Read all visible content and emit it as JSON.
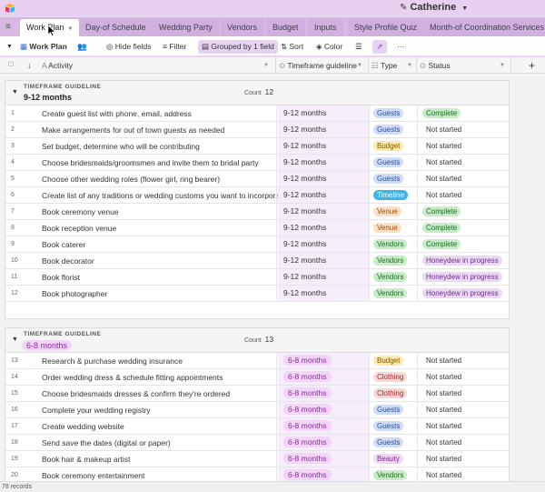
{
  "app": {
    "base_title": "Catherine",
    "pencil_icon": "pencil-icon",
    "brand_colors": {
      "topbar": "#e8d0f0",
      "tabsbar": "#d7b9e4",
      "accent": "#8a3fb8"
    }
  },
  "tabs": [
    {
      "label": "Work Plan",
      "active": true
    },
    {
      "label": "Day-of Schedule"
    },
    {
      "label": "Wedding Party"
    },
    {
      "label": "Vendors"
    },
    {
      "label": "Budget"
    },
    {
      "label": "Inputs"
    },
    {
      "label": "Style Profile Quiz"
    },
    {
      "label": "Month-of Coordination Services"
    }
  ],
  "toolbar": {
    "view_name": "Work Plan",
    "hide_fields": "Hide fields",
    "filter": "Filter",
    "grouped": "Grouped by 1 field",
    "sort": "Sort",
    "color": "Color",
    "more": "···"
  },
  "columns": {
    "activity": "Activity",
    "timeframe": "Timeframe guideline",
    "type": "Type",
    "status": "Status",
    "add": "+"
  },
  "groups": [
    {
      "label": "TIMEFRAME GUIDELINE",
      "value": "9-12 months",
      "count_label": "Count",
      "count": "12",
      "rows": [
        {
          "n": "1",
          "activity": "Create guest list with phone, email, address",
          "tf": "9-12 months",
          "type": "Guests",
          "status": "Complete"
        },
        {
          "n": "2",
          "activity": "Make arrangements for out of town guests as needed",
          "tf": "9-12 months",
          "type": "Guests",
          "status": "Not started"
        },
        {
          "n": "3",
          "activity": "Set budget, determine who will be contributing",
          "tf": "9-12 months",
          "type": "Budget",
          "status": "Not started"
        },
        {
          "n": "4",
          "activity": "Choose bridesmaids/groomsmen and invite them to bridal party",
          "tf": "9-12 months",
          "type": "Guests",
          "status": "Not started"
        },
        {
          "n": "5",
          "activity": "Choose other wedding roles (flower girl, ring bearer)",
          "tf": "9-12 months",
          "type": "Guests",
          "status": "Not started"
        },
        {
          "n": "6",
          "activity": "Create list of any traditions or wedding customs you want to incorporate",
          "tf": "9-12 months",
          "type": "Timeline",
          "status": "Not started"
        },
        {
          "n": "7",
          "activity": "Book ceremony venue",
          "tf": "9-12 months",
          "type": "Venue",
          "status": "Complete"
        },
        {
          "n": "8",
          "activity": "Book reception venue",
          "tf": "9-12 months",
          "type": "Venue",
          "status": "Complete"
        },
        {
          "n": "9",
          "activity": "Book caterer",
          "tf": "9-12 months",
          "type": "Vendors",
          "status": "Complete"
        },
        {
          "n": "10",
          "activity": "Book decorator",
          "tf": "9-12 months",
          "type": "Vendors",
          "status": "Honeydew in progress"
        },
        {
          "n": "11",
          "activity": "Book florist",
          "tf": "9-12 months",
          "type": "Vendors",
          "status": "Honeydew in progress"
        },
        {
          "n": "12",
          "activity": "Book photographer",
          "tf": "9-12 months",
          "type": "Vendors",
          "status": "Honeydew in progress"
        }
      ]
    },
    {
      "label": "TIMEFRAME GUIDELINE",
      "value": "6-8 months",
      "count_label": "Count",
      "count": "13",
      "rows": [
        {
          "n": "13",
          "activity": "Research & purchase wedding insurance",
          "tf": "6-8 months",
          "type": "Budget",
          "status": "Not started"
        },
        {
          "n": "14",
          "activity": "Order wedding dress & schedule fitting appointments",
          "tf": "6-8 months",
          "type": "Clothing",
          "status": "Not started"
        },
        {
          "n": "15",
          "activity": "Choose bridesmaids dresses & confirm they're ordered",
          "tf": "6-8 months",
          "type": "Clothing",
          "status": "Not started"
        },
        {
          "n": "16",
          "activity": "Complete your wedding registry",
          "tf": "6-8 months",
          "type": "Guests",
          "status": "Not started"
        },
        {
          "n": "17",
          "activity": "Create wedding website",
          "tf": "6-8 months",
          "type": "Guests",
          "status": "Not started"
        },
        {
          "n": "18",
          "activity": "Send save the dates (digital or paper)",
          "tf": "6-8 months",
          "type": "Guests",
          "status": "Not started"
        },
        {
          "n": "19",
          "activity": "Book hair & makeup artist",
          "tf": "6-8 months",
          "type": "Beauty",
          "status": "Not started"
        },
        {
          "n": "20",
          "activity": "Book ceremony entertainment",
          "tf": "6-8 months",
          "type": "Vendors",
          "status": "Not started"
        }
      ]
    }
  ],
  "badge_colors": {
    "Guests": {
      "bg": "#cfdcf7",
      "fg": "#2b4f8c"
    },
    "Budget": {
      "bg": "#fde9a8",
      "fg": "#7a5a00"
    },
    "Timeline": {
      "bg": "#3db5e8",
      "fg": "#ffffff"
    },
    "Venue": {
      "bg": "#fde0c4",
      "fg": "#9a4a10"
    },
    "Vendors": {
      "bg": "#c7ecc8",
      "fg": "#1f6b24"
    },
    "Clothing": {
      "bg": "#fbd6d6",
      "fg": "#9a2a2a"
    },
    "Beauty": {
      "bg": "#f1d6f5",
      "fg": "#7a2a8a"
    },
    "Complete": {
      "bg": "#c7ecc8",
      "fg": "#1f6b24"
    },
    "Not started": {
      "bg": "transparent",
      "fg": "#333333"
    },
    "Honeydew in progress": {
      "bg": "#ead9f4",
      "fg": "#6b2f8f"
    }
  },
  "footer": {
    "records": "78 records"
  }
}
